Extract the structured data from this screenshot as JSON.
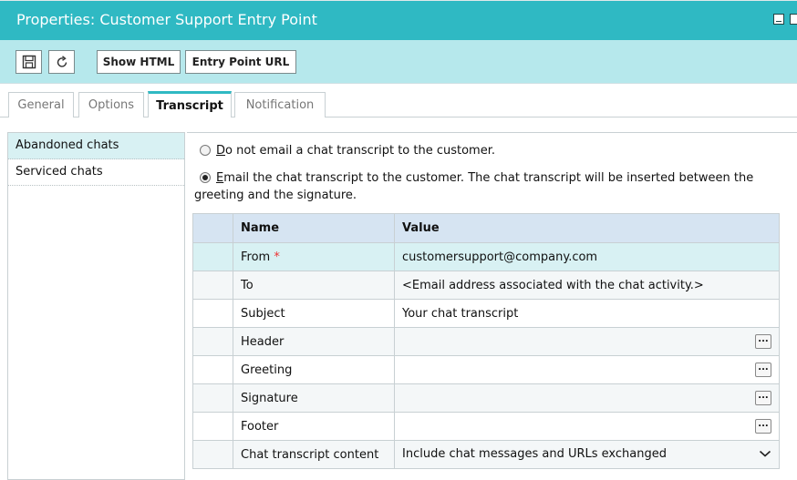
{
  "window": {
    "title": "Properties: Customer Support Entry Point"
  },
  "toolbar": {
    "show_html_label": "Show HTML",
    "entry_point_url_label": "Entry Point URL"
  },
  "tabs": [
    {
      "label": "General"
    },
    {
      "label": "Options"
    },
    {
      "label": "Transcript"
    },
    {
      "label": "Notification"
    }
  ],
  "left_nav": [
    {
      "label": "Abandoned chats"
    },
    {
      "label": "Serviced chats"
    }
  ],
  "options": {
    "do_not_email_prefix": "D",
    "do_not_email_rest": "o not email a chat transcript to the customer.",
    "email_prefix": "E",
    "email_rest": "mail the chat transcript to the customer. The chat transcript will be inserted between the",
    "email_line2": "greeting and the signature."
  },
  "grid": {
    "headers": {
      "name": "Name",
      "value": "Value"
    },
    "rows": [
      {
        "name": "From",
        "value": "customersupport@company.com",
        "required": "*"
      },
      {
        "name": "To",
        "value": "<Email address associated with the chat activity.>"
      },
      {
        "name": "Subject",
        "value": "Your chat transcript"
      },
      {
        "name": "Header",
        "value": ""
      },
      {
        "name": "Greeting",
        "value": ""
      },
      {
        "name": "Signature",
        "value": ""
      },
      {
        "name": "Footer",
        "value": ""
      },
      {
        "name": "Chat transcript content",
        "value": "Include chat messages and URLs exchanged"
      }
    ],
    "ellipsis": "..."
  },
  "colors": {
    "accent": "#2fb9c3",
    "toolbar": "#b6e8ec",
    "selected_row": "#d8f1f3",
    "header": "#d6e4f2"
  }
}
